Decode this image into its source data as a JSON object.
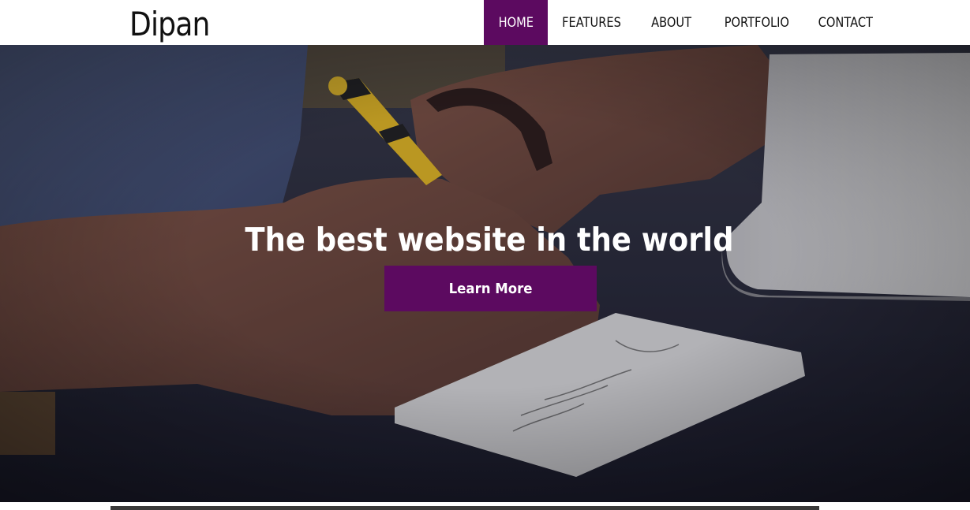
{
  "header": {
    "logo": "Dipan",
    "nav": [
      {
        "label": "HOME",
        "active": true
      },
      {
        "label": "FEATURES",
        "active": false
      },
      {
        "label": "ABOUT",
        "active": false
      },
      {
        "label": "PORTFOLIO",
        "active": false
      },
      {
        "label": "CONTACT",
        "active": false
      }
    ]
  },
  "hero": {
    "title": "The best website in the world",
    "button_label": "Learn More"
  },
  "colors": {
    "accent": "#5c0a60",
    "header_bg": "#ffffff",
    "text_dark": "#111111",
    "text_light": "#ffffff"
  }
}
